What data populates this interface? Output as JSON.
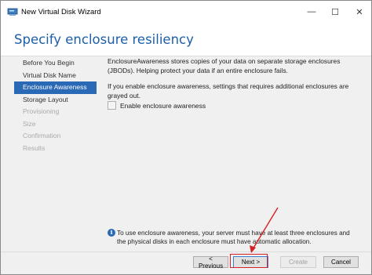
{
  "window": {
    "title": "New Virtual Disk Wizard"
  },
  "title_controls": {
    "minimize": "—",
    "maximize": "☐",
    "close": "✕"
  },
  "header": {
    "title": "Specify enclosure resiliency"
  },
  "nav": {
    "items": [
      {
        "label": "Before You Begin",
        "state": "normal"
      },
      {
        "label": "Virtual Disk Name",
        "state": "normal"
      },
      {
        "label": "Enclosure Awareness",
        "state": "active"
      },
      {
        "label": "Storage Layout",
        "state": "normal"
      },
      {
        "label": "Provisioning",
        "state": "disabled"
      },
      {
        "label": "Size",
        "state": "disabled"
      },
      {
        "label": "Confirmation",
        "state": "disabled"
      },
      {
        "label": "Results",
        "state": "disabled"
      }
    ]
  },
  "content": {
    "paragraph1": "EnclosureAwareness stores copies of your data on separate storage enclosures (JBODs). Helping protect your data if an entire enclosure fails.",
    "paragraph2": "If you enable enclosure awareness, settings that requires additional enclosures are grayed out.",
    "checkbox_label": "Enable enclosure awareness",
    "checkbox_checked": false
  },
  "info": {
    "icon": "info-icon",
    "text": "To use enclosure awareness, your server must have at least three enclosures and the physical disks in each enclosure must have automatic allocation."
  },
  "buttons": {
    "previous": "< Previous",
    "next": "Next >",
    "create": "Create",
    "cancel": "Cancel"
  },
  "colors": {
    "accent": "#2a69b6",
    "title": "#1c5fa8",
    "annotation": "#d71f26"
  }
}
